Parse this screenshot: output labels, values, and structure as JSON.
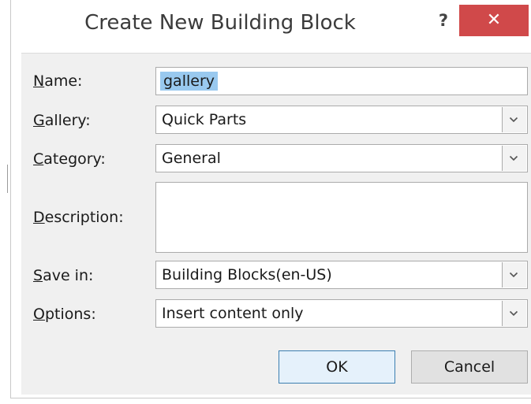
{
  "dialog": {
    "title": "Create New Building Block",
    "help_label": "?",
    "close_label": "✕"
  },
  "fields": {
    "name": {
      "label_key": "N",
      "label_rest": "ame:",
      "value": "gallery"
    },
    "gallery": {
      "label_key": "G",
      "label_rest": "allery:",
      "value": "Quick Parts"
    },
    "category": {
      "label_key": "C",
      "label_rest": "ategory:",
      "value": "General"
    },
    "description": {
      "label_key": "D",
      "label_rest": "escription:",
      "value": ""
    },
    "save_in": {
      "label_key": "S",
      "label_rest": "ave in:",
      "value": "Building Blocks(en-US)"
    },
    "options": {
      "label_key": "O",
      "label_rest": "ptions:",
      "value": "Insert content only"
    }
  },
  "buttons": {
    "ok": "OK",
    "cancel": "Cancel"
  },
  "icons": {
    "dropdown": "chevron-down-icon",
    "close": "close-icon",
    "help": "help-icon"
  },
  "colors": {
    "close_button": "#d0494a",
    "selection": "#99c9ef",
    "panel": "#f0f0f0",
    "default_button_border": "#3c7fb1"
  }
}
